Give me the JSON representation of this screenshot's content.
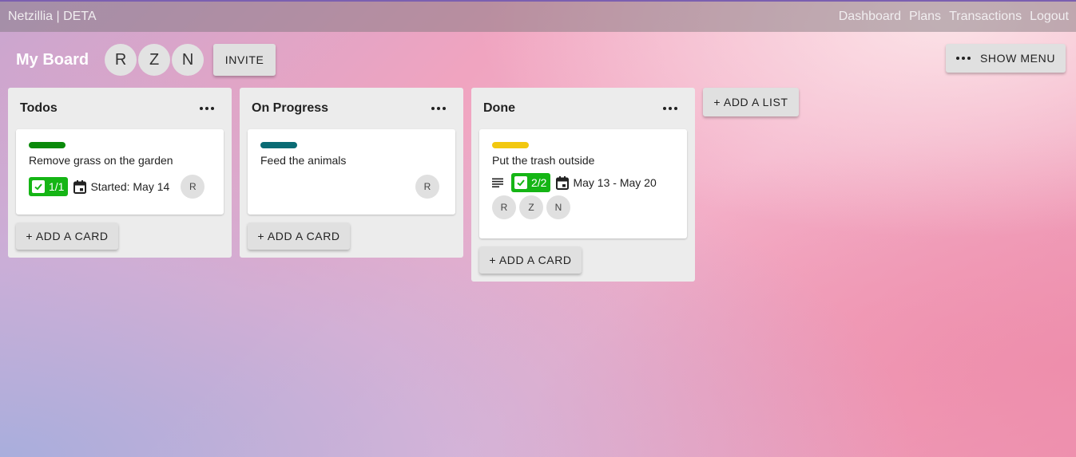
{
  "topbar": {
    "brand": "Netzillia | DETA",
    "nav": [
      "Dashboard",
      "Plans",
      "Transactions",
      "Logout"
    ]
  },
  "board": {
    "title": "My Board",
    "members": [
      "R",
      "Z",
      "N"
    ],
    "invite_label": "INVITE",
    "show_menu_label": "SHOW MENU",
    "add_list_label": "+ ADD A LIST"
  },
  "lists": [
    {
      "title": "Todos",
      "add_card_label": "+ ADD A CARD",
      "cards": [
        {
          "label_color": "#0a8a0a",
          "title": "Remove grass on the garden",
          "checklist": "1/1",
          "date": "Started: May 14",
          "members": [
            "R"
          ]
        }
      ]
    },
    {
      "title": "On Progress",
      "add_card_label": "+ ADD A CARD",
      "cards": [
        {
          "label_color": "#0a6b74",
          "title": "Feed the animals",
          "members": [
            "R"
          ]
        }
      ]
    },
    {
      "title": "Done",
      "add_card_label": "+ ADD A CARD",
      "cards": [
        {
          "label_color": "#f2c80f",
          "title": "Put the trash outside",
          "has_description": true,
          "checklist": "2/2",
          "date": "May 13 - May 20",
          "members": [
            "R",
            "Z",
            "N"
          ]
        }
      ]
    }
  ],
  "colors": {
    "checklist_complete": "#15b515",
    "button_bg": "#e0e0e0",
    "list_bg": "#ececec"
  }
}
